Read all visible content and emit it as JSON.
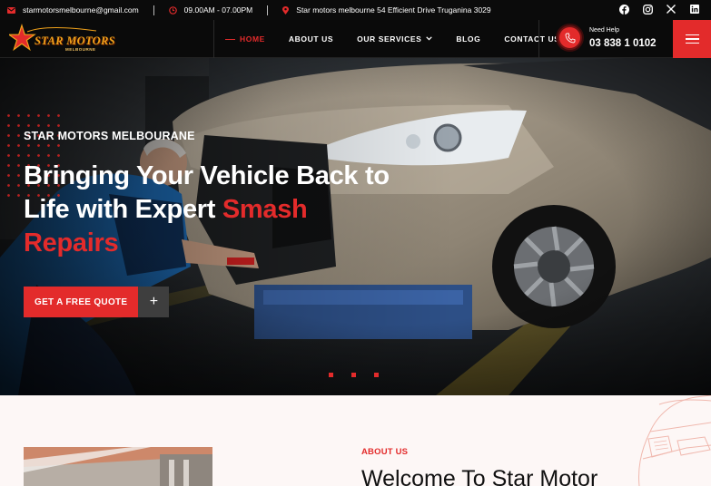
{
  "topbar": {
    "email": "starmotorsmelbourne@gmail.com",
    "hours": "09.00AM - 07.00PM",
    "address": "Star motors melbourne 54 Efficient Drive Truganina 3029",
    "socials": [
      "facebook-icon",
      "instagram-icon",
      "x-icon",
      "linkedin-icon"
    ]
  },
  "logo": {
    "name": "STAR MOTORS",
    "sub": "MELBOURNE"
  },
  "nav": {
    "items": [
      {
        "label": "HOME",
        "active": true
      },
      {
        "label": "ABOUT US"
      },
      {
        "label": "OUR SERVICES",
        "dropdown": true
      },
      {
        "label": "BLOG"
      },
      {
        "label": "CONTACT US"
      }
    ],
    "help_label": "Need Help",
    "help_phone": "03 838 1 0102"
  },
  "hero": {
    "eyebrow": "STAR MOTORS MELBOURANE",
    "title_line1": "Bringing Your Vehicle Back to",
    "title_line2_white": "Life with Expert ",
    "title_line2_red": "Smash",
    "title_line3_red": "Repairs",
    "cta_label": "GET A FREE QUOTE",
    "cta_plus": "+"
  },
  "about": {
    "label": "ABOUT US",
    "title": "Welcome To Star Motor"
  },
  "colors": {
    "accent": "#e32b2b",
    "dark": "#0b0b0b",
    "logo_gold": "#f0a21b"
  }
}
